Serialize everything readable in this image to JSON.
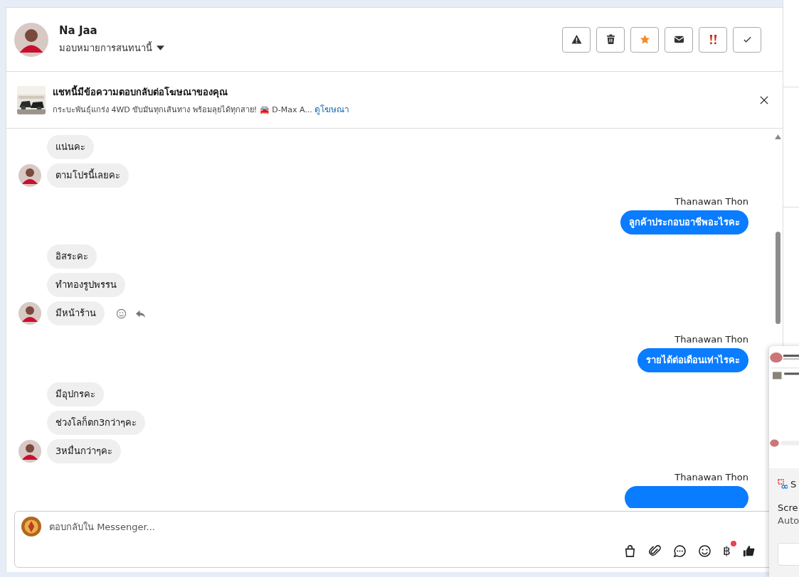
{
  "header": {
    "name": "Na Jaa",
    "assign_label": "มอบหมายการสนทนานี้"
  },
  "toolbar_buttons": [
    {
      "kind": "warning"
    },
    {
      "kind": "trash"
    },
    {
      "kind": "star"
    },
    {
      "kind": "envelope"
    },
    {
      "kind": "urgent"
    },
    {
      "kind": "check"
    }
  ],
  "ad_banner": {
    "title": "แชทนี้มีข้อความตอบกลับต่อโฆษณาของคุณ",
    "description": "กระบะพันธุ์แกร่ง 4WD ขับมันทุกเส้นทาง พร้อมลุยได้ทุกสาย! 🚘 D-Max A...",
    "link": "ดูโฆษณา"
  },
  "messages": [
    {
      "kind": "in",
      "text": "แน่นคะ",
      "avatar": false,
      "actions": false
    },
    {
      "kind": "in",
      "text": "ตามโปรนี้เลยคะ",
      "avatar": true,
      "actions": false
    },
    {
      "kind": "out",
      "sender": "Thanawan Thon",
      "text": "ลูกค้าประกอบอาชีพอะไรคะ"
    },
    {
      "kind": "in",
      "text": "อิสระคะ",
      "avatar": false,
      "actions": false
    },
    {
      "kind": "in",
      "text": "ทำทองรูปพรรน",
      "avatar": false,
      "actions": false
    },
    {
      "kind": "in",
      "text": "มีหน้าร้าน",
      "avatar": true,
      "actions": true
    },
    {
      "kind": "out",
      "sender": "Thanawan Thon",
      "text": "รายได้ต่อเดือนเท่าไรคะ"
    },
    {
      "kind": "in",
      "text": "มีอุปกรคะ",
      "avatar": false,
      "actions": false
    },
    {
      "kind": "in",
      "text": "ช่วงโลก็ตก3กว่าๆคะ",
      "avatar": false,
      "actions": false
    },
    {
      "kind": "in",
      "text": "3หมื่นกว่าๆคะ",
      "avatar": true,
      "actions": false
    },
    {
      "kind": "out-cut",
      "sender": "Thanawan Thon"
    }
  ],
  "composer": {
    "placeholder": "ตอบกลับใน Messenger...",
    "tools": [
      {
        "kind": "bag"
      },
      {
        "kind": "clip"
      },
      {
        "kind": "chat"
      },
      {
        "kind": "emoji"
      },
      {
        "kind": "baht",
        "glyph": "฿",
        "badge": true
      },
      {
        "kind": "like"
      }
    ]
  },
  "notification": {
    "app_initial": "S",
    "title": "Scre",
    "subtitle": "Auto"
  }
}
